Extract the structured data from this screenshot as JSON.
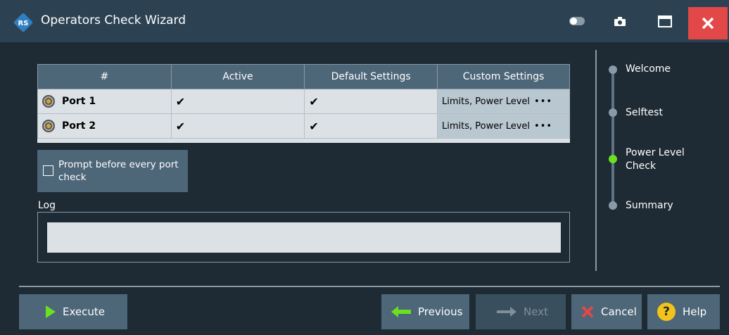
{
  "window": {
    "title": "Operators Check Wizard"
  },
  "table": {
    "headers": [
      "#",
      "Active",
      "Default Settings",
      "Custom Settings"
    ],
    "rows": [
      {
        "port": "Port 1",
        "active": "✔",
        "default": "✔",
        "custom": "Limits, Power Level",
        "more": "•••"
      },
      {
        "port": "Port 2",
        "active": "✔",
        "default": "✔",
        "custom": "Limits, Power Level",
        "more": "•••"
      }
    ]
  },
  "prompt": {
    "label": "Prompt before every port check",
    "checked": false
  },
  "log": {
    "label": "Log",
    "value": ""
  },
  "steps": [
    {
      "label": "Welcome",
      "state": "done"
    },
    {
      "label": "Selftest",
      "state": "done"
    },
    {
      "label": "Power Level Check",
      "state": "current"
    },
    {
      "label": "Summary",
      "state": "pending"
    }
  ],
  "buttons": {
    "execute": "Execute",
    "previous": "Previous",
    "next": "Next",
    "cancel": "Cancel",
    "help": "Help"
  },
  "colors": {
    "titlebar": "#2c4253",
    "background": "#1e2a34",
    "accent_green": "#6be020",
    "close_red": "#e24848",
    "help_yellow": "#f3c31a"
  }
}
